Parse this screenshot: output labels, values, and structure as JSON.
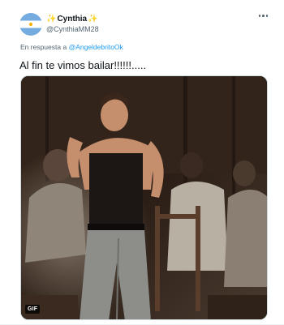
{
  "user": {
    "sparkle_left": "✨",
    "name": "Cynthia",
    "sparkle_right": "✨",
    "handle": "@CynthiaMM28",
    "avatar_icon": "argentina-flag-avatar"
  },
  "reply": {
    "prefix": "En respuesta a",
    "mention": "@AngeldebritoOk"
  },
  "tweet": {
    "text": "Al fin te vimos bailar!!!!!!....."
  },
  "media": {
    "badge": "GIF",
    "description_icon": "dancing-man-gif"
  },
  "colors": {
    "link": "#1d9bf0",
    "secondary_text": "#536471",
    "primary_text": "#0f1419"
  }
}
